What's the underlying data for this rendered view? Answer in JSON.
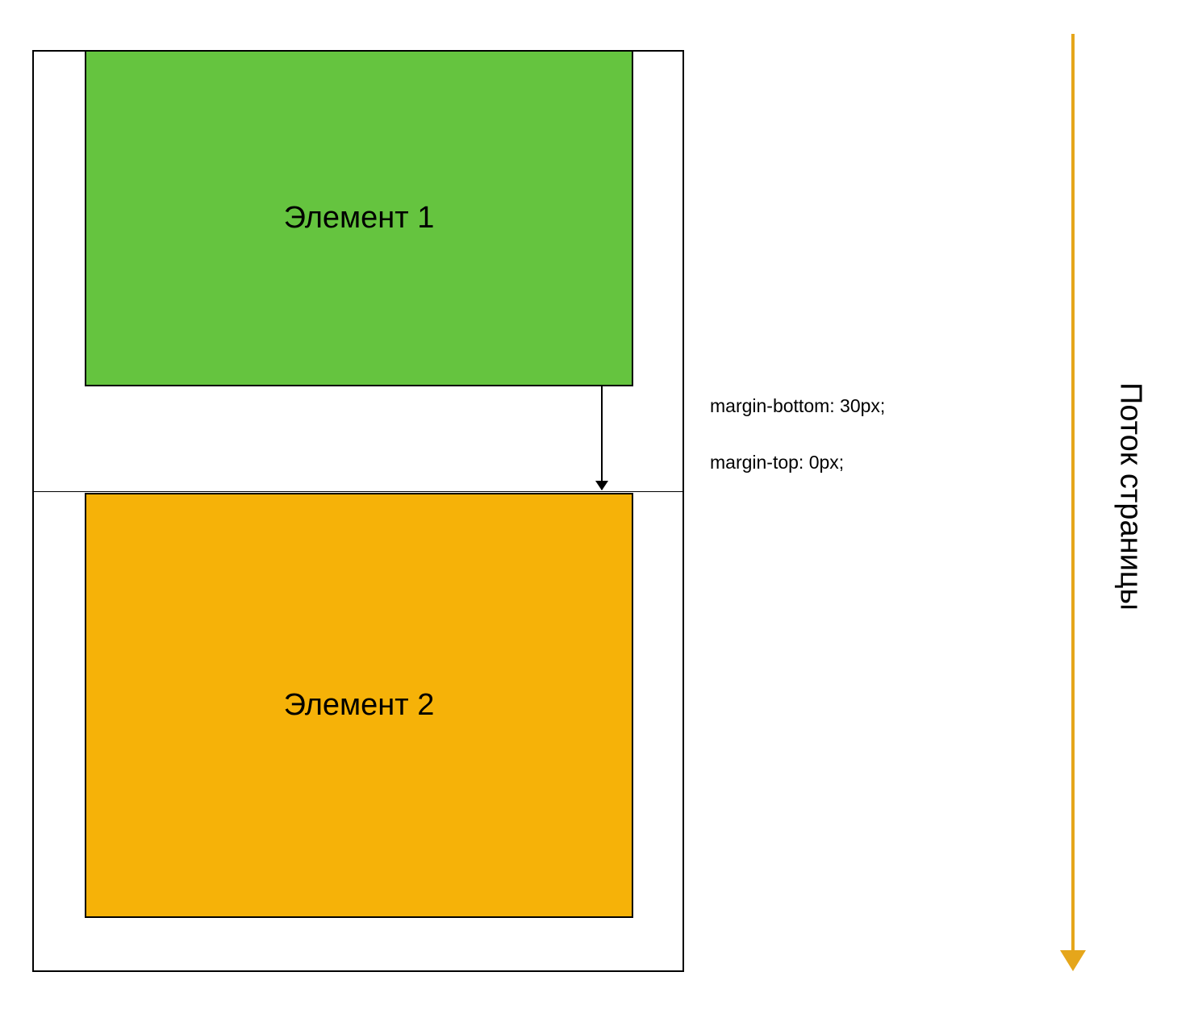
{
  "diagram": {
    "element1_label": "Элемент 1",
    "element2_label": "Элемент 2",
    "margin_bottom_label": "margin-bottom: 30px;",
    "margin_top_label": "margin-top: 0px;",
    "flow_label": "Поток страницы",
    "colors": {
      "element1_bg": "#65c43f",
      "element2_bg": "#f6b208",
      "flow_arrow": "#e5a61b",
      "border": "#000000"
    }
  }
}
